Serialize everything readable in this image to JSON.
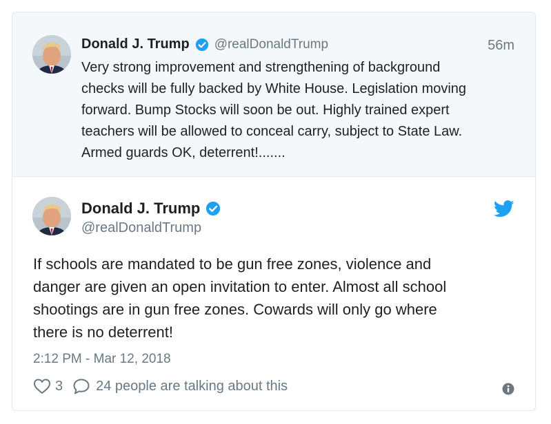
{
  "parent_tweet": {
    "author_name": "Donald J. Trump",
    "handle": "@realDonaldTrump",
    "time_ago": "56m",
    "text": "Very strong improvement and strengthening of background\nchecks will be fully backed by White House. Legislation moving\nforward. Bump Stocks will soon be out. Highly trained expert\nteachers will be allowed to conceal carry, subject to State Law.\nArmed guards OK, deterrent!......."
  },
  "main_tweet": {
    "author_name": "Donald J. Trump",
    "handle": "@realDonaldTrump",
    "text": "If schools are mandated to be gun free zones, violence and\ndanger are given an open invitation to enter. Almost all school\nshootings are in gun free zones. Cowards will only go where\nthere is no deterrent!",
    "timestamp": "2:12 PM - Mar 12, 2018",
    "like_count": "3",
    "talking_text": "24 people are talking about this"
  },
  "colors": {
    "verified_blue": "#1da1f2",
    "muted_text": "#697882",
    "parent_background": "#f5f8fa"
  },
  "icons": {
    "verified": "verified-badge-icon",
    "twitter": "twitter-bird-icon",
    "like": "heart-icon",
    "reply": "speech-bubble-icon",
    "info": "info-icon"
  }
}
